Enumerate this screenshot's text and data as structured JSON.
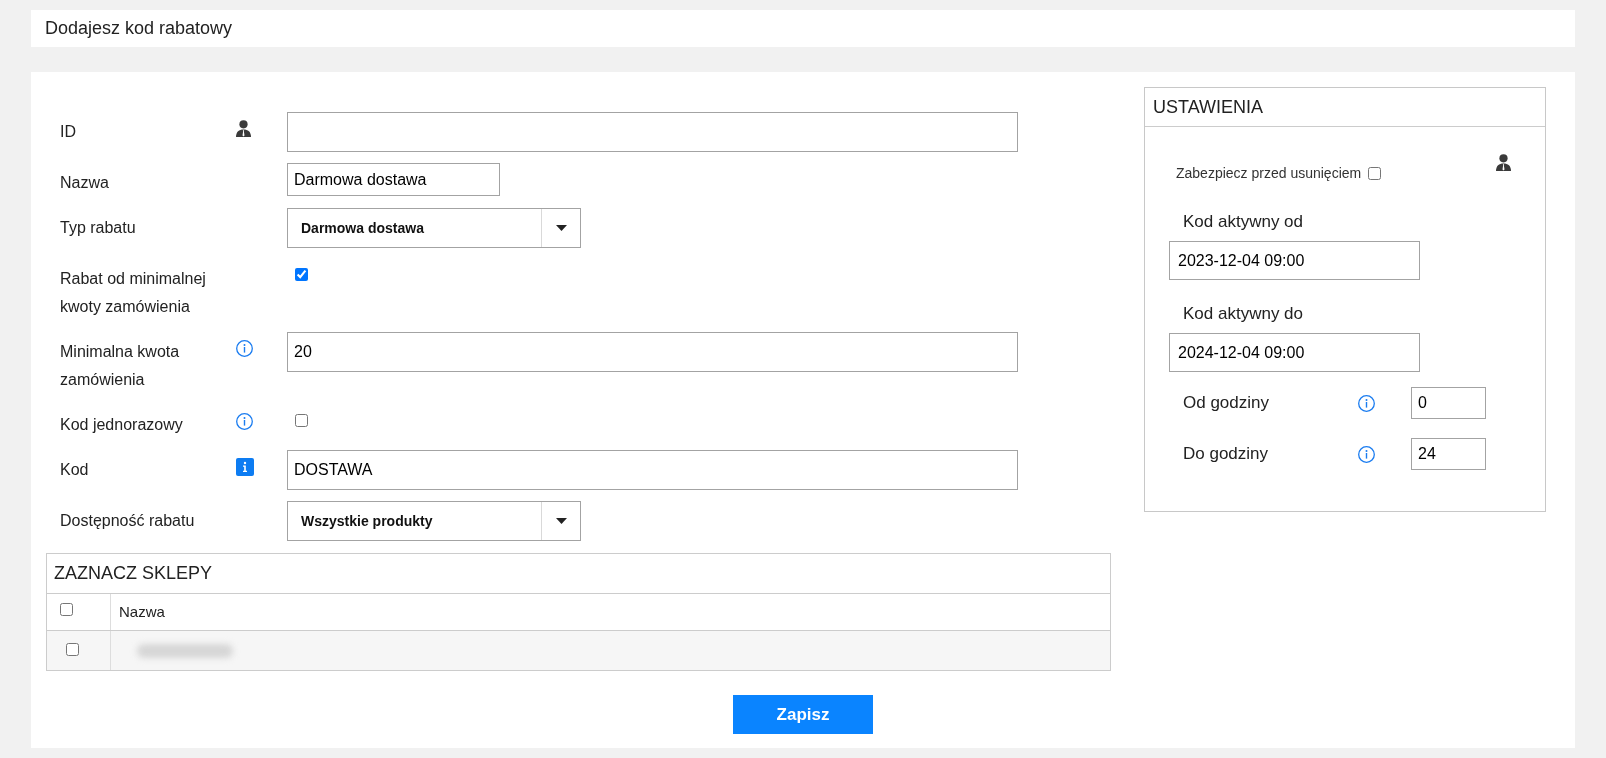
{
  "header": {
    "title": "Dodajesz kod rabatowy"
  },
  "form": {
    "fields": [
      {
        "kind": "text",
        "label": "ID",
        "admin_only": true
      },
      {
        "kind": "short_text",
        "label": "Nazwa",
        "value": "Darmowa dostawa"
      },
      {
        "kind": "select",
        "label": "Typ rabatu",
        "value": "Darmowa dostawa"
      },
      {
        "kind": "checkbox",
        "label": "Rabat od minimalnej kwoty zamówienia",
        "checked": true
      },
      {
        "kind": "text",
        "label": "Minimalna kwota zamówienia",
        "value": "20",
        "help": true
      },
      {
        "kind": "checkbox",
        "label": "Kod jednorazowy",
        "checked": false,
        "help": true
      },
      {
        "kind": "text",
        "label": "Kod",
        "value": "DOSTAWA",
        "help": true,
        "help_highlighted": true
      },
      {
        "kind": "select",
        "label": "Dostępność rabatu",
        "value": "Wszystkie produkty"
      }
    ]
  },
  "shops": {
    "title": "ZAZNACZ SKLEPY",
    "header_checked": false,
    "columns": [
      {
        "label": "Nazwa"
      }
    ],
    "rows": [
      {
        "checked": false
      }
    ]
  },
  "settings": {
    "title": "USTAWIENIA",
    "protect": {
      "label": "Zabezpiecz przed usunięciem",
      "checked": false,
      "admin_only": true
    },
    "dates": [
      {
        "label": "Kod aktywny od",
        "value": "2023-12-04 09:00"
      },
      {
        "label": "Kod aktywny do",
        "value": "2024-12-04 09:00"
      }
    ],
    "hours": [
      {
        "label": "Od godziny",
        "value": "0",
        "help": true
      },
      {
        "label": "Do godziny",
        "value": "24",
        "help": true
      }
    ]
  },
  "actions": [
    {
      "label": "Zapisz",
      "kind": "primary"
    }
  ]
}
